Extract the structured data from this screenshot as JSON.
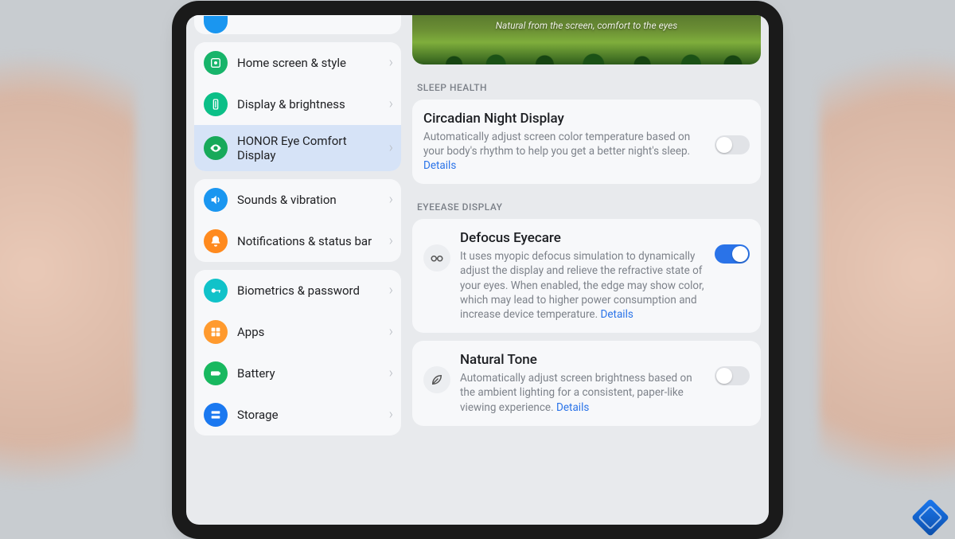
{
  "banner": {
    "caption": "Natural from the screen, comfort to the eyes"
  },
  "sidebar": {
    "groups": [
      {
        "items": [
          {
            "label": "Home screen & style",
            "icon": "home-style-icon",
            "color": "c-green"
          },
          {
            "label": "Display & brightness",
            "icon": "brightness-icon",
            "color": "c-teal"
          },
          {
            "label": "HONOR Eye Comfort Display",
            "icon": "eye-comfort-icon",
            "color": "c-eye",
            "active": true
          }
        ]
      },
      {
        "items": [
          {
            "label": "Sounds & vibration",
            "icon": "sound-icon",
            "color": "c-blue"
          },
          {
            "label": "Notifications & status bar",
            "icon": "bell-icon",
            "color": "c-orange"
          }
        ]
      },
      {
        "items": [
          {
            "label": "Biometrics & password",
            "icon": "key-icon",
            "color": "c-cyan"
          },
          {
            "label": "Apps",
            "icon": "apps-icon",
            "color": "c-orange2"
          },
          {
            "label": "Battery",
            "icon": "battery-icon",
            "color": "c-green2"
          },
          {
            "label": "Storage",
            "icon": "storage-icon",
            "color": "c-blue2"
          }
        ]
      }
    ]
  },
  "sections": {
    "sleep_health": {
      "header": "SLEEP HEALTH",
      "items": [
        {
          "title": "Circadian Night Display",
          "desc": "Automatically adjust screen color temperature based on your body's rhythm to help you get a better night's sleep.",
          "details": "Details",
          "on": false
        }
      ]
    },
    "eyeease": {
      "header": "EYEEASE DISPLAY",
      "items": [
        {
          "title": "Defocus Eyecare",
          "desc": "It uses myopic defocus simulation to dynamically adjust the display and relieve the refractive state of your eyes. When enabled, the edge may show color, which may lead to higher power consumption and increase device temperature.",
          "details": "Details",
          "icon": "glasses-icon",
          "on": true
        },
        {
          "title": "Natural Tone",
          "desc": "Automatically adjust screen brightness based on the ambient lighting for a consistent, paper-like viewing experience.",
          "details": "Details",
          "icon": "leaf-icon",
          "on": false
        }
      ]
    }
  }
}
